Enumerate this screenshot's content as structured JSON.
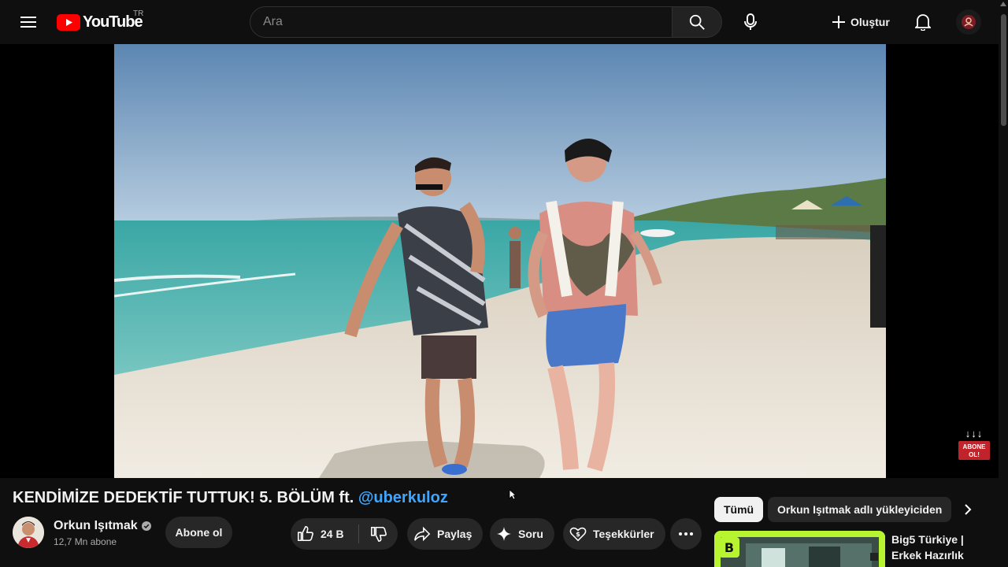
{
  "header": {
    "logo_text": "YouTube",
    "country_code": "TR",
    "search_placeholder": "Ara",
    "create_label": "Oluştur"
  },
  "player": {
    "subscribe_overlay_label": "ABONE OL!"
  },
  "video": {
    "title": "KENDİMİZE DEDEKTİF TUTTUK! 5. BÖLÜM ft. ",
    "title_mention": "@uberkuloz",
    "channel_name": "Orkun Işıtmak",
    "subscribers": "12,7 Mn abone",
    "subscribe_label": "Abone ol",
    "like_count": "24 B",
    "share_label": "Paylaş",
    "ask_label": "Soru",
    "thanks_label": "Teşekkürler"
  },
  "sidebar": {
    "chips": [
      "Tümü",
      "Orkun Işıtmak adlı yükleyiciden"
    ],
    "recommendation_title": "Big5 Türkiye | Erkek Hazırlık"
  },
  "colors": {
    "background": "#0f0f0f",
    "accent_red": "#ff0000",
    "link_blue": "#3ea6ff",
    "button_bg": "#272727"
  }
}
